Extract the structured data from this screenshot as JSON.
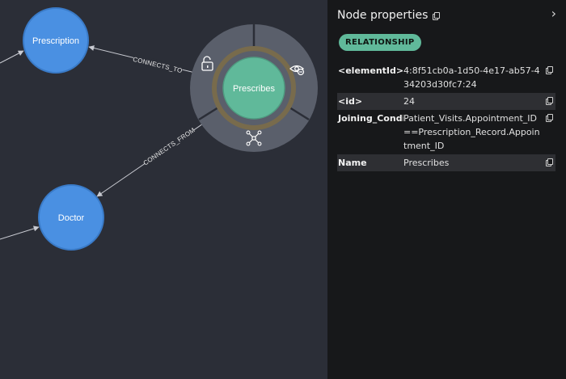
{
  "graph": {
    "nodes": {
      "prescription": "Prescription",
      "doctor": "Doctor",
      "prescribes": "Prescribes"
    },
    "edges": {
      "connects_to": "CONNECTS_TO",
      "connects_from": "CONNECTS_FROM"
    },
    "node_color": "#4a90e2",
    "selected_node_color": "#60b99a",
    "ring_menu": [
      "unlock-icon",
      "hide-icon",
      "expand-icon"
    ]
  },
  "panel": {
    "title": "Node properties",
    "badge": "RELATIONSHIP",
    "badge_color": "#60b99a",
    "properties": [
      {
        "key": "<elementId>",
        "value": "4:8f51cb0a-1d50-4e17-ab57-434203d30fc7:24"
      },
      {
        "key": "<id>",
        "value": "24"
      },
      {
        "key": "Joining_Condi",
        "value": "Patient_Visits.Appointment_ID==Prescription_Record.Appointment_ID"
      },
      {
        "key": "Name",
        "value": "Prescribes"
      }
    ]
  }
}
